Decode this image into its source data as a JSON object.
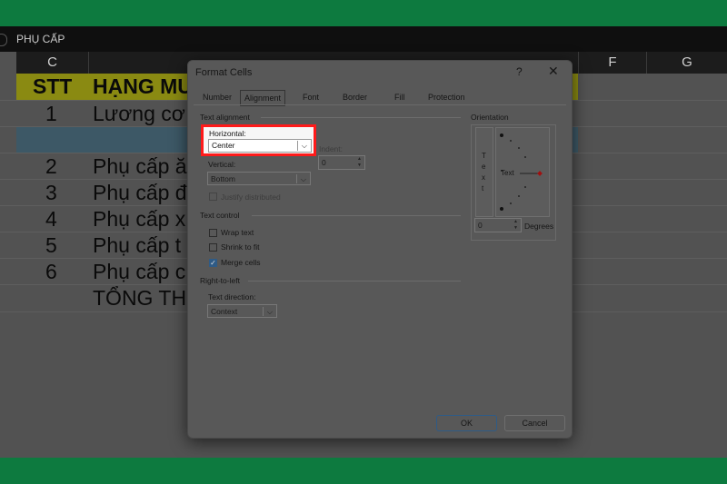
{
  "formula_bar": {
    "value": "PHỤ CẤP"
  },
  "sheet": {
    "columns": [
      "C",
      "",
      "F",
      "G"
    ],
    "header_row": {
      "stt": "STT",
      "item": "HẠNG MU"
    },
    "rows": [
      {
        "stt": "1",
        "item": "Lương cơ"
      },
      {
        "stt": "",
        "item": ""
      },
      {
        "stt": "2",
        "item": "Phụ cấp ă"
      },
      {
        "stt": "3",
        "item": "Phụ cấp đ"
      },
      {
        "stt": "4",
        "item": "Phụ cấp x"
      },
      {
        "stt": "5",
        "item": "Phụ cấp t"
      },
      {
        "stt": "6",
        "item": "Phụ cấp c"
      },
      {
        "stt": "",
        "item": "TỔNG TH"
      }
    ],
    "right_edge_glyphs": [
      ")",
      ")",
      ")",
      ")",
      ")",
      ")"
    ]
  },
  "dialog": {
    "title": "Format Cells",
    "help": "?",
    "close": "✕",
    "tabs": [
      "Number",
      "Alignment",
      "Font",
      "Border",
      "Fill",
      "Protection"
    ],
    "active_tab": "Alignment",
    "text_alignment": {
      "section": "Text alignment",
      "horizontal_label": "Horizontal:",
      "horizontal_value": "Center",
      "indent_label": "Indent:",
      "indent_value": "0",
      "vertical_label": "Vertical:",
      "vertical_value": "Bottom",
      "justify_distributed": "Justify distributed"
    },
    "text_control": {
      "section": "Text control",
      "wrap_text": "Wrap text",
      "shrink_to_fit": "Shrink to fit",
      "merge_cells": "Merge cells",
      "wrap_checked": false,
      "shrink_checked": false,
      "merge_checked": true
    },
    "rtl": {
      "section": "Right-to-left",
      "direction_label": "Text direction:",
      "direction_value": "Context"
    },
    "orientation": {
      "section": "Orientation",
      "vertical_text": [
        "T",
        "e",
        "x",
        "t"
      ],
      "dial_text": "Text",
      "degrees_value": "0",
      "degrees_label": "Degrees"
    },
    "ok": "OK",
    "cancel": "Cancel"
  },
  "colors": {
    "brand_band": "#0d7a3f",
    "highlight": "#ff1a1a",
    "check": "#2f5b86"
  }
}
